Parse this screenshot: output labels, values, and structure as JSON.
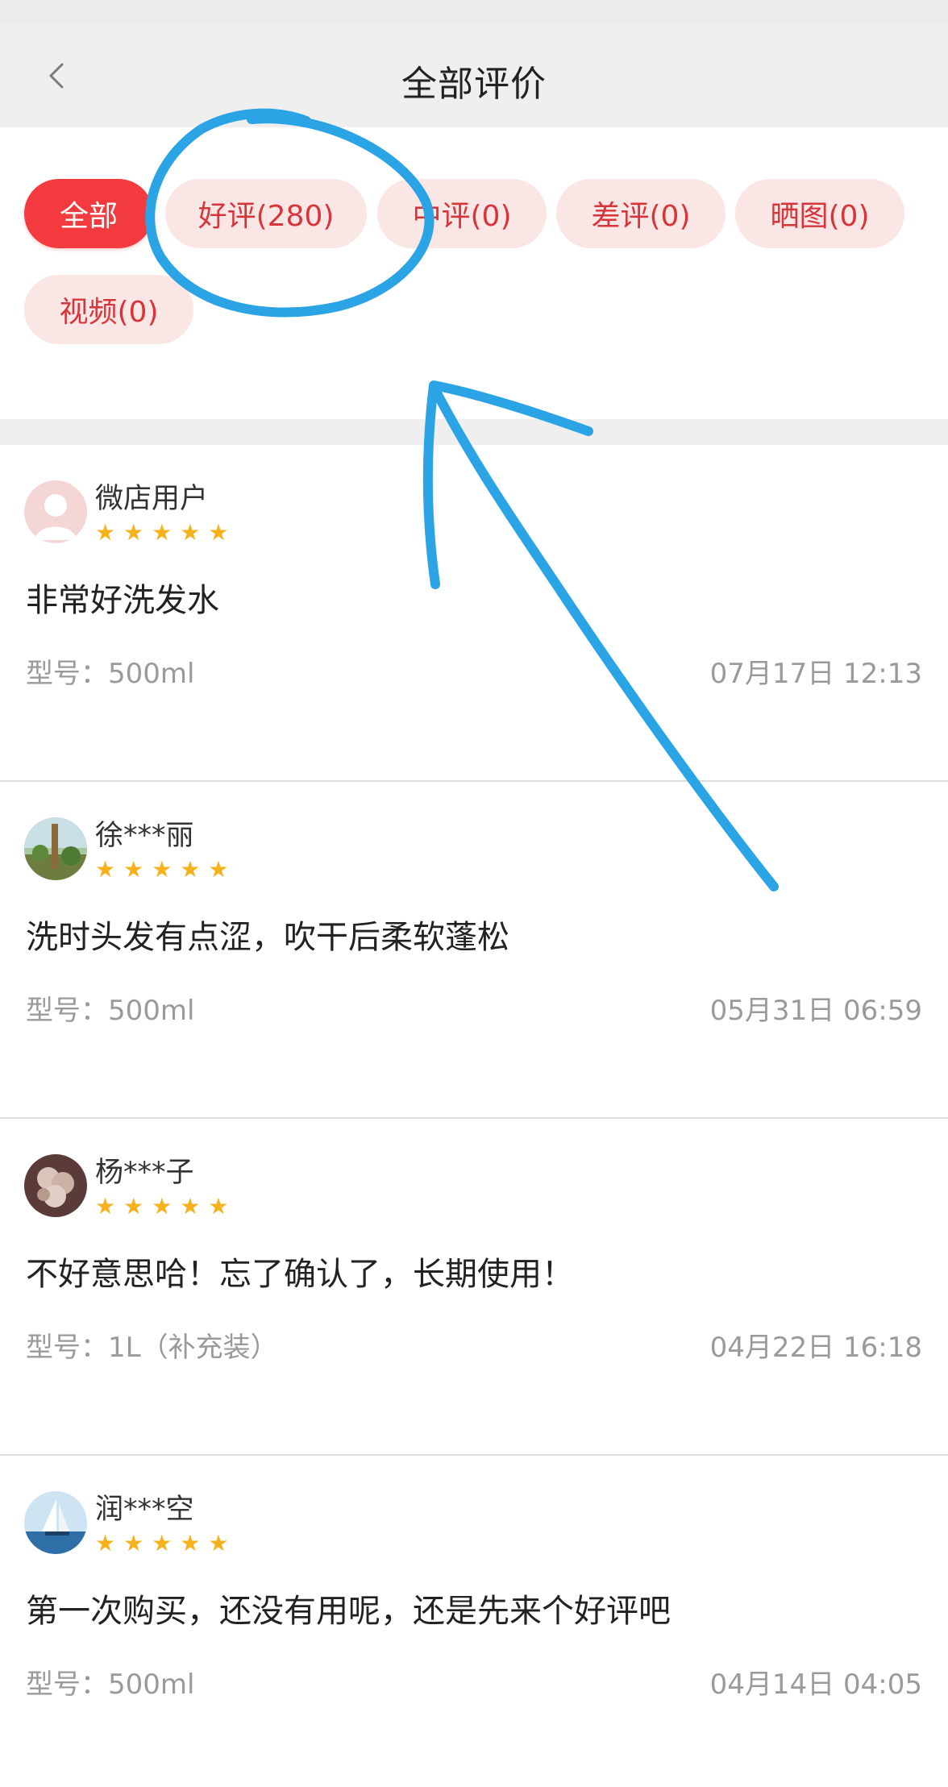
{
  "header": {
    "title": "全部评价"
  },
  "filters": [
    {
      "label": "全部",
      "active": true
    },
    {
      "label": "好评(280)",
      "active": false
    },
    {
      "label": "中评(0)",
      "active": false
    },
    {
      "label": "差评(0)",
      "active": false
    },
    {
      "label": "晒图(0)",
      "active": false
    },
    {
      "label": "视频(0)",
      "active": false
    }
  ],
  "reviews": [
    {
      "user": "微店用户",
      "stars": "★★★★★",
      "content": "非常好洗发水",
      "model": "型号：500ml",
      "time": "07月17日 12:13"
    },
    {
      "user": "徐***丽",
      "stars": "★★★★★",
      "content": "洗时头发有点涩，吹干后柔软蓬松",
      "model": "型号：500ml",
      "time": "05月31日 06:59"
    },
    {
      "user": "杨***子",
      "stars": "★★★★★",
      "content": "不好意思哈！忘了确认了，长期使用！",
      "model": "型号：1L（补充装）",
      "time": "04月22日 16:18"
    },
    {
      "user": "润***空",
      "stars": "★★★★★",
      "content": "第一次购买，还没有用呢，还是先来个好评吧",
      "model": "型号：500ml",
      "time": "04月14日 04:05"
    }
  ],
  "colors": {
    "accent": "#f23a3f",
    "chip_bg": "#fbe6e6",
    "chip_text": "#d6353a",
    "star": "#f5b21d",
    "annotation": "#2ba4e6"
  }
}
